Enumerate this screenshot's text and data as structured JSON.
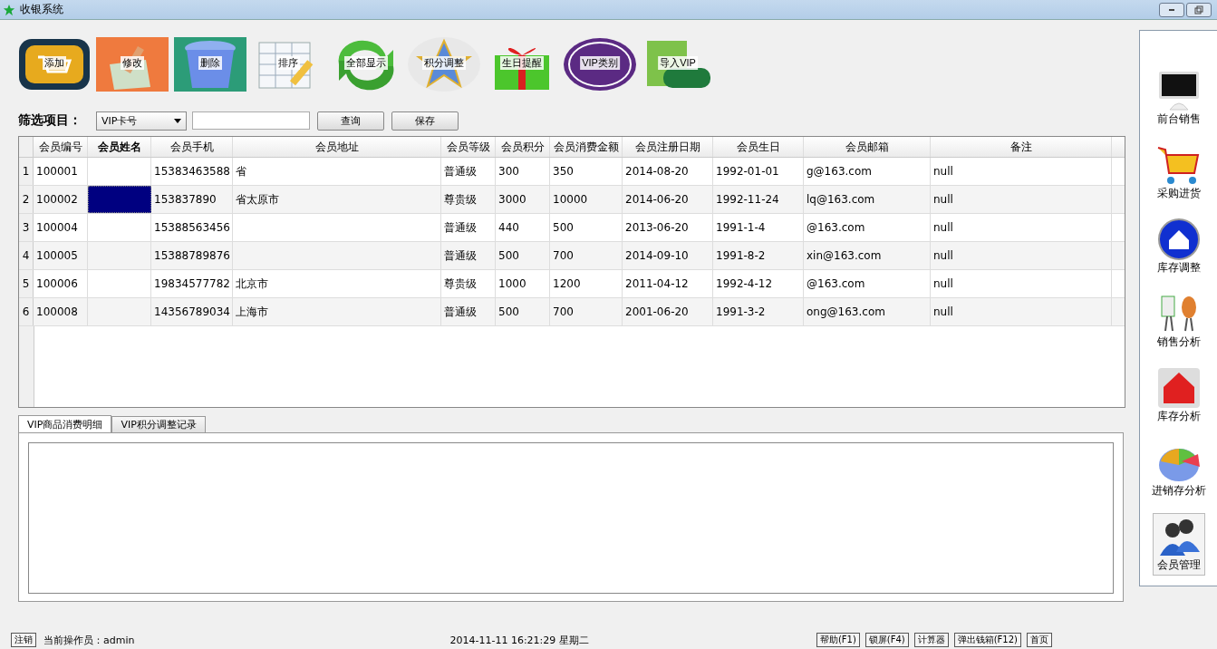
{
  "window": {
    "title": "收银系统"
  },
  "toolbar": [
    {
      "label": "添加"
    },
    {
      "label": "修改"
    },
    {
      "label": "删除"
    },
    {
      "label": "排序"
    },
    {
      "label": "全部显示"
    },
    {
      "label": "积分调整"
    },
    {
      "label": "生日提醒"
    },
    {
      "label": "VIP类别"
    },
    {
      "label": "导入VIP"
    }
  ],
  "filter": {
    "label": "筛选项目：",
    "select_value": "VIP卡号",
    "query_button": "查询",
    "save_button": "保存"
  },
  "table": {
    "columns": [
      "会员编号",
      "会员姓名",
      "会员手机",
      "会员地址",
      "会员等级",
      "会员积分",
      "会员消费金额",
      "会员注册日期",
      "会员生日",
      "会员邮箱",
      "备注"
    ],
    "rows": [
      {
        "index": "1",
        "selected": false,
        "cells": [
          "100001",
          "",
          "15383463588",
          "省",
          "普通级",
          "300",
          "350",
          "2014-08-20",
          "1992-01-01",
          "g@163.com",
          "null"
        ]
      },
      {
        "index": "2",
        "selected": true,
        "cells": [
          "100002",
          "",
          "153837890",
          "省太原市",
          "尊贵级",
          "3000",
          "10000",
          "2014-06-20",
          "1992-11-24",
          "lq@163.com",
          "null"
        ]
      },
      {
        "index": "3",
        "selected": false,
        "cells": [
          "100004",
          "",
          "15388563456",
          "",
          "普通级",
          "440",
          "500",
          "2013-06-20",
          "1991-1-4",
          "@163.com",
          "null"
        ]
      },
      {
        "index": "4",
        "selected": false,
        "cells": [
          "100005",
          "",
          "15388789876",
          "",
          "普通级",
          "500",
          "700",
          "2014-09-10",
          "1991-8-2",
          "xin@163.com",
          "null"
        ]
      },
      {
        "index": "5",
        "selected": false,
        "cells": [
          "100006",
          "",
          "19834577782",
          "北京市",
          "尊贵级",
          "1000",
          "1200",
          "2011-04-12",
          "1992-4-12",
          "@163.com",
          "null"
        ]
      },
      {
        "index": "6",
        "selected": false,
        "cells": [
          "100008",
          "",
          "14356789034",
          "上海市",
          "普通级",
          "500",
          "700",
          "2001-06-20",
          "1991-3-2",
          "ong@163.com",
          "null"
        ]
      }
    ]
  },
  "tabs": [
    {
      "label": "VIP商品消费明细",
      "selected": true
    },
    {
      "label": "VIP积分调整记录",
      "selected": false
    }
  ],
  "sidebar": {
    "items": [
      {
        "label": "前台销售",
        "selected": false
      },
      {
        "label": "采购进货",
        "selected": false
      },
      {
        "label": "库存调整",
        "selected": false
      },
      {
        "label": "销售分析",
        "selected": false
      },
      {
        "label": "库存分析",
        "selected": false
      },
      {
        "label": "进销存分析",
        "selected": false
      },
      {
        "label": "会员管理",
        "selected": true
      }
    ]
  },
  "status_bar": {
    "logout_button": "注销",
    "operator": "当前操作员：admin",
    "datetime": "2014-11-11 16:21:29 星期二",
    "buttons": [
      "帮助(F1)",
      "锁屏(F4)",
      "计算器",
      "弹出钱箱(F12)",
      "首页"
    ]
  }
}
